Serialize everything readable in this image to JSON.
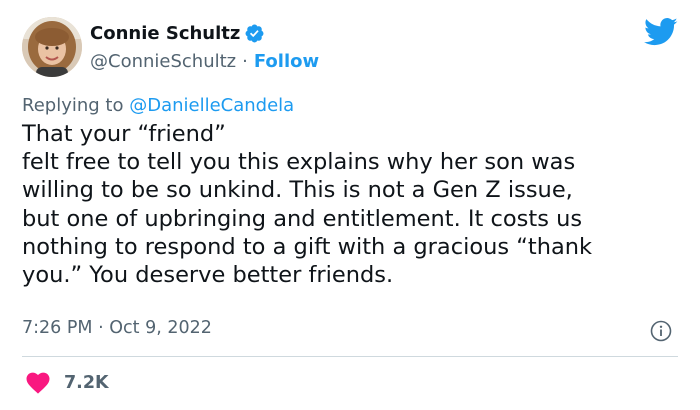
{
  "author": {
    "display_name": "Connie Schultz",
    "handle": "@ConnieSchultz",
    "separator": "·",
    "follow_label": "Follow",
    "avatar_icon": "avatar-photo",
    "verified_icon": "verified-badge-icon"
  },
  "reply": {
    "prefix": "Replying to ",
    "mention": "@DanielleCandela"
  },
  "body_lines": [
    "That your “friend”",
    "felt free to tell you this explains why her son was",
    "willing to be so unkind. This is not a Gen Z issue,",
    "but one of upbringing and entitlement. It costs us",
    "nothing to respond to a gift with a gracious “thank",
    "you.” You deserve better friends."
  ],
  "meta": {
    "time": "7:26 PM",
    "separator": "·",
    "date": "Oct 9, 2022"
  },
  "likes": {
    "count": "7.2K",
    "icon": "heart-icon"
  },
  "colors": {
    "twitter_blue": "#1d9bf0",
    "like_red": "#f91880",
    "secondary_text": "#536471",
    "primary_text": "#0f1419",
    "divider": "#cfd9de"
  }
}
